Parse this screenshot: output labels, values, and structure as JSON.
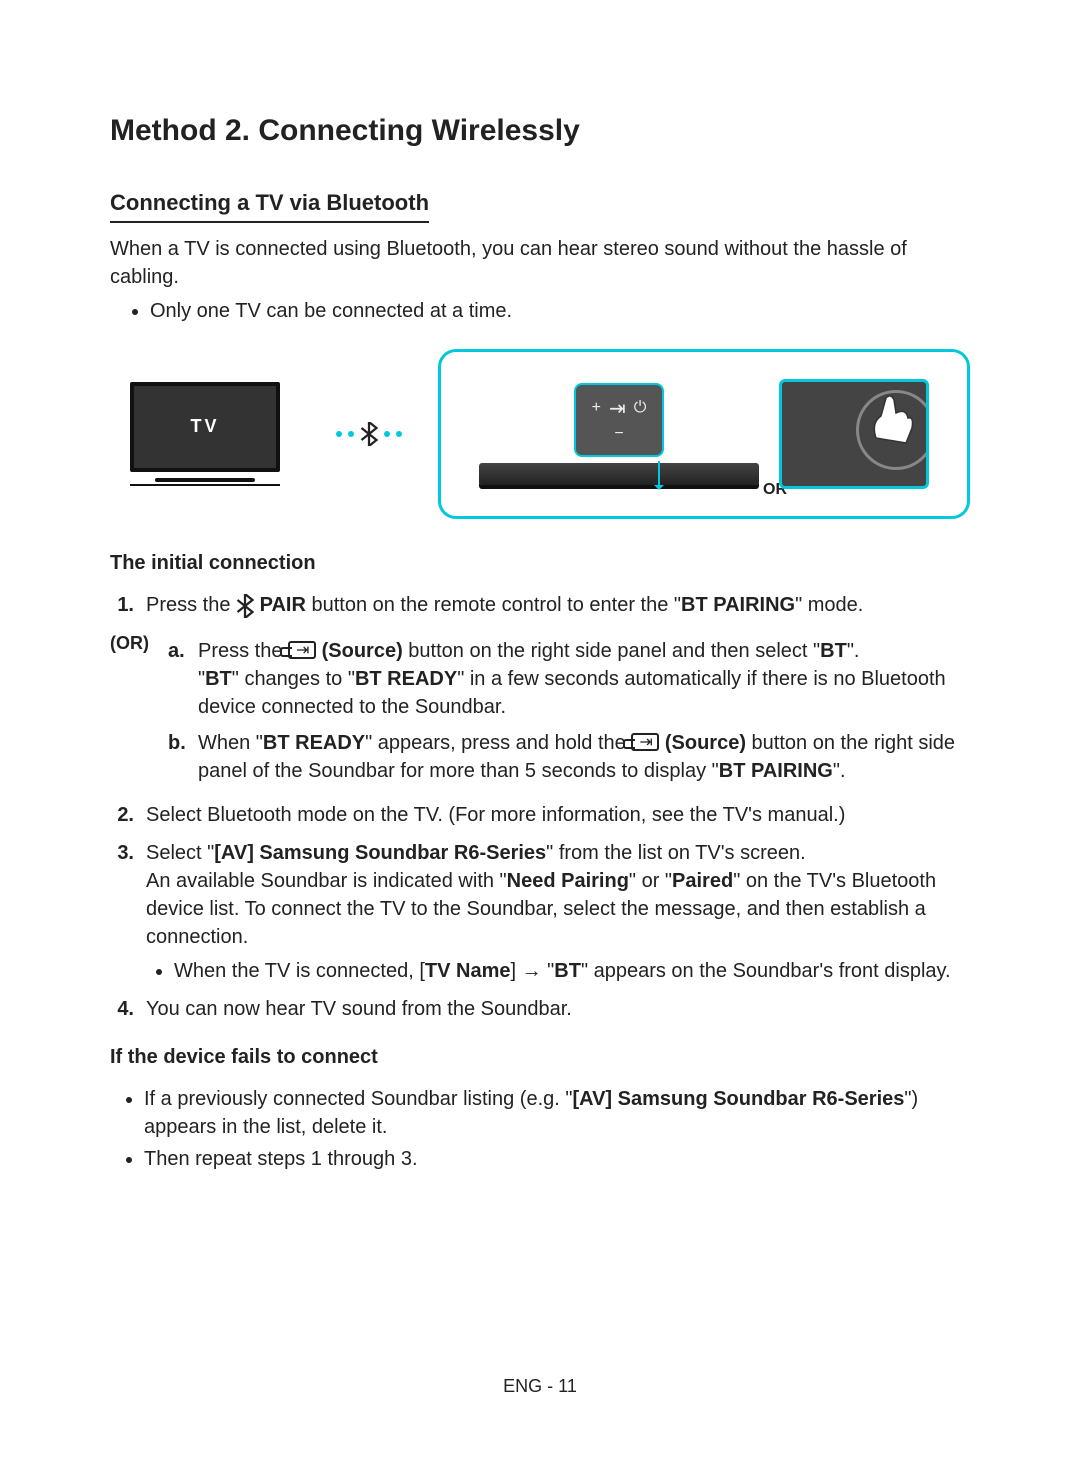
{
  "title": "Method 2. Connecting Wirelessly",
  "subtitle": "Connecting a TV via Bluetooth",
  "intro": "When a TV is connected using Bluetooth, you can hear stereo sound without the hassle of cabling.",
  "intro_bullet": "Only one TV can be connected at a time.",
  "diagram": {
    "tv_label": "TV",
    "or_label": "OR"
  },
  "section_initial": "The initial connection",
  "or_text": "(OR)",
  "steps": {
    "s1": {
      "num": "1.",
      "pre": "Press the ",
      "bold_pair": " PAIR",
      "mid": " button on the remote control to enter the \"",
      "bold_btpairing": "BT PAIRING",
      "post": "\" mode."
    },
    "a": {
      "letter": "a.",
      "pre": "Press the ",
      "bold_source": " (Source)",
      "mid": " button on the right side panel and then select \"",
      "bold_bt": "BT",
      "post": "\".",
      "line2_pre": "\"",
      "line2_bold1": "BT",
      "line2_mid": "\" changes to \"",
      "line2_bold2": "BT READY",
      "line2_post": "\" in a few seconds automatically if there is no Bluetooth device connected to the Soundbar."
    },
    "b": {
      "letter": "b.",
      "pre": "When \"",
      "bold_ready": "BT READY",
      "mid": "\" appears, press and hold the ",
      "bold_source": " (Source)",
      "mid2": " button on the right side panel of the Soundbar for more than 5 seconds to display \"",
      "bold_pairing": "BT PAIRING",
      "post": "\"."
    },
    "s2": {
      "num": "2.",
      "text": "Select Bluetooth mode on the TV. (For more information, see the TV's manual.)"
    },
    "s3": {
      "num": "3.",
      "pre": "Select \"",
      "bold_av": "[AV] Samsung Soundbar R6-Series",
      "mid": "\" from the list on TV's screen.",
      "line2_pre": "An available Soundbar is indicated with \"",
      "line2_bold1": "Need Pairing",
      "line2_mid": "\" or \"",
      "line2_bold2": "Paired",
      "line2_post": "\" on the TV's Bluetooth device list. To connect the TV to the Soundbar, select the message, and then establish a connection.",
      "bullet_pre": "When the TV is connected, [",
      "bullet_bold1": "TV Name",
      "bullet_mid": "] → \"",
      "bullet_bold2": "BT",
      "bullet_post": "\" appears on the Soundbar's front display."
    },
    "s4": {
      "num": "4.",
      "text": "You can now hear TV sound from the Soundbar."
    }
  },
  "section_fail": "If the device fails to connect",
  "fail": {
    "b1_pre": "If a previously connected Soundbar listing (e.g. \"",
    "b1_bold": "[AV] Samsung Soundbar R6-Series",
    "b1_post": "\") appears in the list, delete it.",
    "b2": "Then repeat steps 1 through 3."
  },
  "footer": "ENG - 11"
}
